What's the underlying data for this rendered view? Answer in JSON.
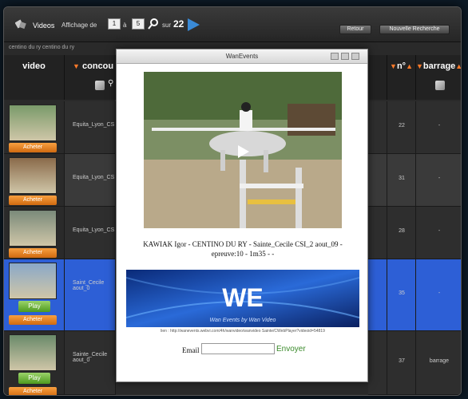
{
  "toolbar": {
    "videos_label": "Videos",
    "affichage_label": "Affichage de",
    "from_value": "1",
    "a_label": "à",
    "to_value": "5",
    "sur_label": "sur",
    "total": "22",
    "retour_label": "Retour",
    "nouvelle_label": "Nouvelle Recherche"
  },
  "breadcrumb": "centino du ry centino du ry",
  "columns": {
    "video": "video",
    "concours": "concou",
    "num": "n°",
    "barrage": "barrage"
  },
  "rows": [
    {
      "concours": "Equita_Lyon_CS",
      "num": "22",
      "barrage": "-",
      "action": "Acheter",
      "selected": false
    },
    {
      "concours": "Equita_Lyon_CS",
      "num": "31",
      "barrage": "-",
      "action": "Acheter",
      "selected": false
    },
    {
      "concours": "Equita_Lyon_CS",
      "num": "28",
      "barrage": "-",
      "action": "Acheter",
      "selected": false
    },
    {
      "concours": "Saint_Cecile aout_0",
      "num": "35",
      "barrage": "-",
      "play": "Play",
      "action": "Acheter",
      "selected": true
    },
    {
      "concours": "Sainte_Cecile aout_0",
      "num": "37",
      "barrage": "barrage",
      "play": "Play",
      "action": "Acheter",
      "selected": false
    }
  ],
  "modal": {
    "title": "WanEvents",
    "caption": "KAWIAK Igor - CENTINO DU RY - Sainte_Cecile CSI_2 aout_09 - epreuve:10 - 1m35 - -",
    "banner_tagline": "Wan Events by Wan Video",
    "url": "lien : http://wanevents.webvi.com/4h/wanvideo/wanvideo Sainte/CWebPlayer?videoid=54819",
    "email_label": "Email",
    "email_value": "",
    "send_label": "Envoyer"
  },
  "colors": {
    "accent_blue": "#2d5fd6",
    "buy_orange": "#e8841f",
    "play_green": "#6bb83a",
    "send_green": "#3a8a2a"
  }
}
